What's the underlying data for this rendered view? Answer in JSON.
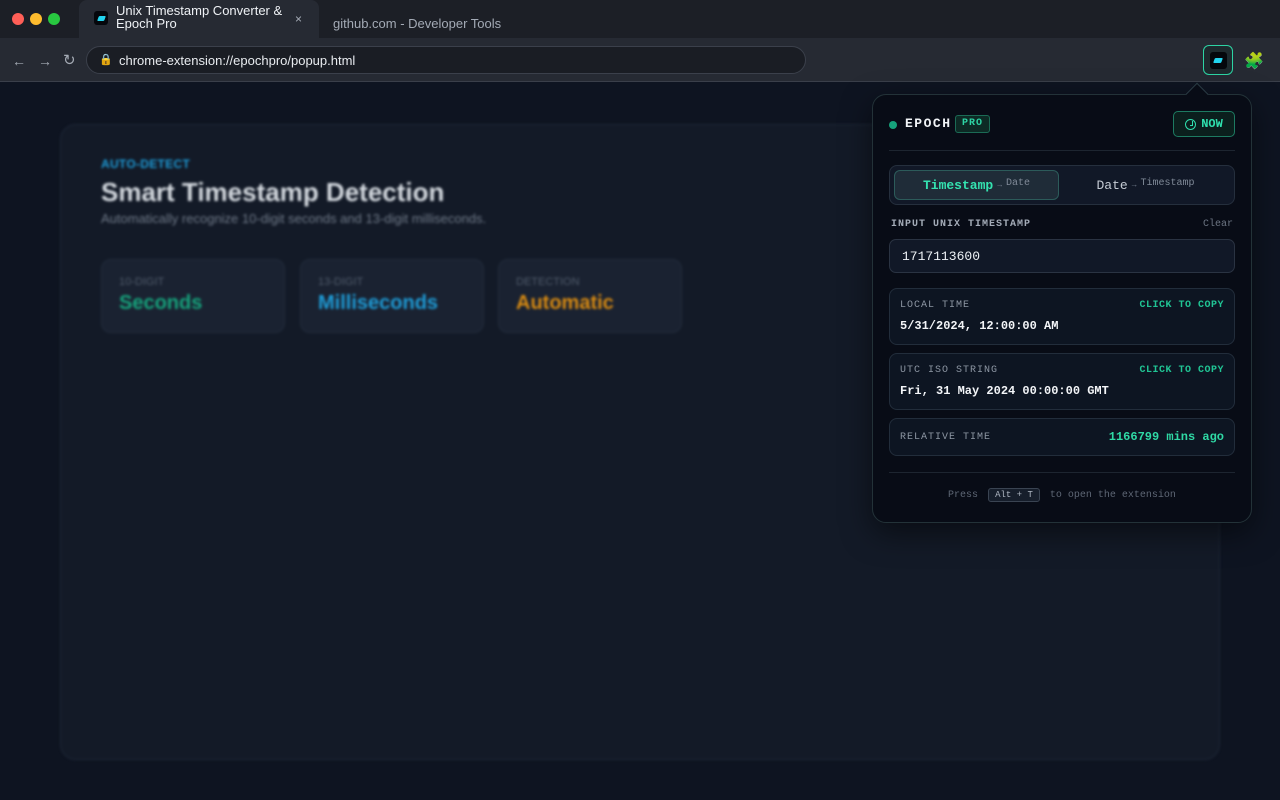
{
  "browser": {
    "active_tab": {
      "title": "Unix Timestamp Converter & Epoch Pro",
      "close_icon": "×"
    },
    "inactive_tab": {
      "title": "github.com - Developer Tools"
    },
    "nav": {
      "back": "←",
      "forward": "→",
      "reload": "↻"
    },
    "url": "chrome-extension://epochpro/popup.html",
    "lock_icon": "🔒",
    "extensions_icon": "🧩"
  },
  "page": {
    "eyebrow": "AUTO-DETECT",
    "title": "Smart Timestamp Detection",
    "subtitle": "Automatically recognize 10-digit seconds and 13-digit milliseconds.",
    "stats": [
      {
        "label": "10-DIGIT",
        "value": "Seconds",
        "color": "#16a37c"
      },
      {
        "label": "13-DIGIT",
        "value": "Milliseconds",
        "color": "#1e9bd6"
      },
      {
        "label": "DETECTION",
        "value": "Automatic",
        "color": "#d98b12"
      }
    ]
  },
  "popup": {
    "brand": "EPOCH",
    "badge": "PRO",
    "now_label": "NOW",
    "modes": [
      {
        "main": "Timestamp",
        "arrow": "→",
        "sub": "Date"
      },
      {
        "main": "Date",
        "arrow": "→",
        "sub": "Timestamp"
      }
    ],
    "input_label": "INPUT UNIX TIMESTAMP",
    "clear_label": "Clear",
    "input_value": "1717113600",
    "results": {
      "local": {
        "label": "LOCAL TIME",
        "copy": "CLICK TO COPY",
        "value": "5/31/2024, 12:00:00 AM"
      },
      "utc": {
        "label": "UTC ISO STRING",
        "copy": "CLICK TO COPY",
        "value": "Fri, 31 May 2024 00:00:00 GMT"
      },
      "relative": {
        "label": "RELATIVE TIME",
        "value": "1166799 mins ago"
      }
    },
    "footer": {
      "pre": "Press",
      "shortcut": "Alt + T",
      "post": "to open the extension"
    }
  }
}
